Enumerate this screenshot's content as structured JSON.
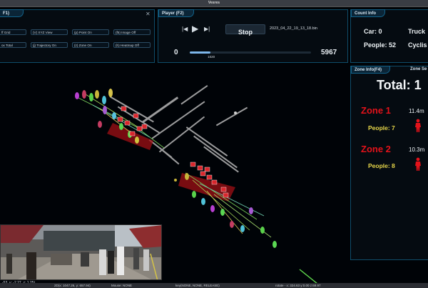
{
  "window": {
    "title": "Vesres"
  },
  "view_panel": {
    "tab": "F1)",
    "options": [
      "ff Grid",
      "(V) XYZ View",
      "(p) Point On",
      "(f5) Image Off",
      "ox Total",
      "(j) Trajectory On",
      "(z) Zone On",
      "(h) Heatmap Off"
    ]
  },
  "player": {
    "tab": "Player (F2)",
    "stop_label": "Stop",
    "file": "2023_04_22_19_13_18.bin",
    "start": "0",
    "end": "5967",
    "current": "1020",
    "progress": 0.171
  },
  "count_info": {
    "tab": "Count Info",
    "car": "Car: 0",
    "truck": "Truck",
    "people": "People: 52",
    "cyclist": "Cyclis"
  },
  "zone_info": {
    "tab": "Zone Info(F4)",
    "tab2": "Zone Se",
    "total": "Total: 1",
    "zones": [
      {
        "name": "Zone 1",
        "area": "11.4m",
        "people": "People: 7"
      },
      {
        "name": "Zone 2",
        "area": "10.3m",
        "people": "People: 8"
      }
    ]
  },
  "camera_overlay": {
    "coords": "-53, y: -2.27, z: 1.25)"
  },
  "status_bar": {
    "screen": "2D(x: 1047.26, y: 657.94)",
    "mouse": "Mouse: NONE",
    "key": "key(NONE, NONE, RELEASE)",
    "rotate": "rotate - x: 324.63 y:0.00 z:69.97"
  },
  "colors": {
    "accent": "#0f4d6a",
    "zone": "#e3121a",
    "people": "#e9d84a"
  }
}
